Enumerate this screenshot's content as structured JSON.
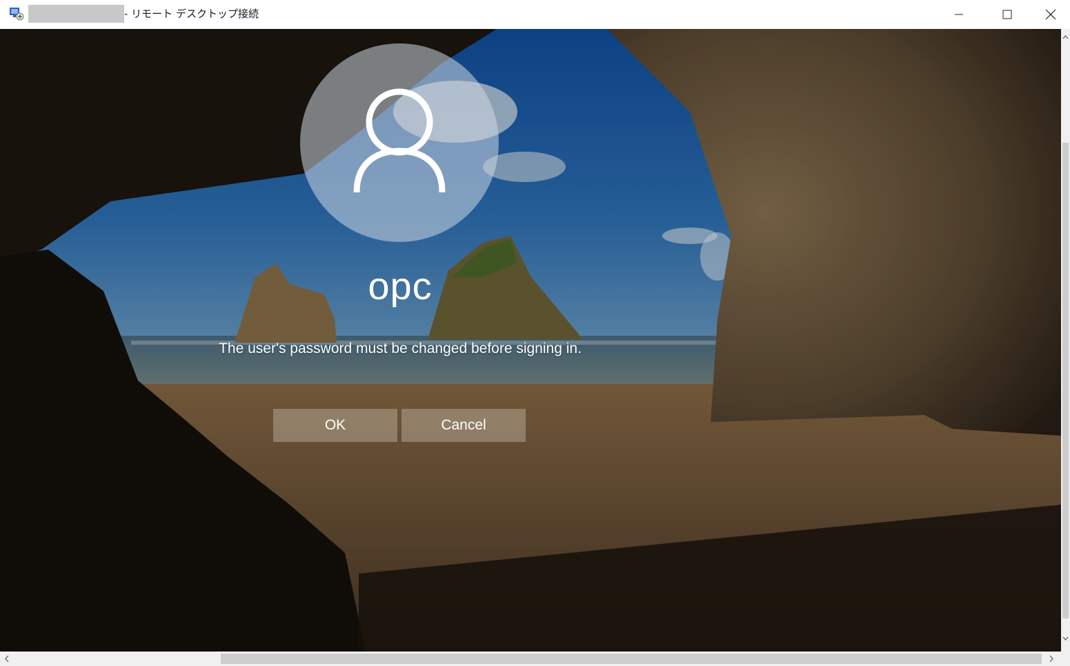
{
  "window": {
    "title_suffix": "- リモート デスクトップ接続",
    "icon": "remote-desktop-icon",
    "controls": {
      "minimize": "minimize-icon",
      "maximize": "maximize-icon",
      "close": "close-icon"
    }
  },
  "login": {
    "avatar_icon": "user-icon",
    "username": "opc",
    "message": "The user's password must be changed before signing in.",
    "ok_label": "OK",
    "cancel_label": "Cancel"
  },
  "colors": {
    "titlebar_bg": "#ffffff",
    "button_bg": "rgba(200,190,175,0.42)",
    "text": "#ffffff",
    "scrollbar_track": "#f0f0f0",
    "scrollbar_thumb": "#cdcdcd"
  }
}
